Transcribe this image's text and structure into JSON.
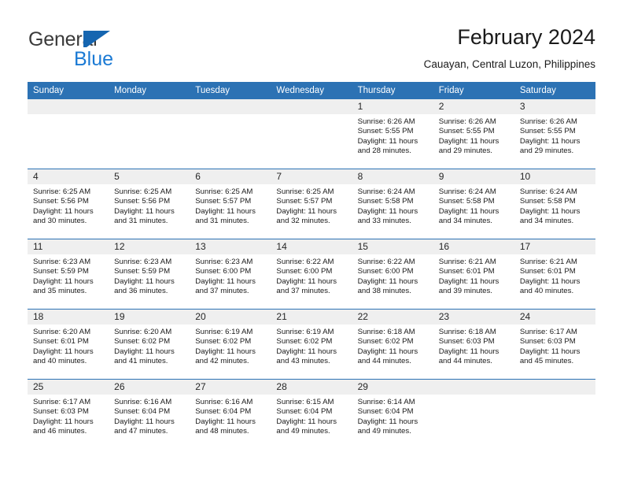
{
  "brand": {
    "name_part1": "General",
    "name_part2": "Blue",
    "flag_color": "#1565b0",
    "blue_color": "#1b7ad4"
  },
  "header": {
    "title": "February 2024",
    "subtitle": "Cauayan, Central Luzon, Philippines"
  },
  "theme": {
    "header_blue": "#2c72b4",
    "date_strip_gray": "#efefef",
    "text_color": "#1a1a1a"
  },
  "calendar": {
    "weekday_headers": [
      "Sunday",
      "Monday",
      "Tuesday",
      "Wednesday",
      "Thursday",
      "Friday",
      "Saturday"
    ],
    "weeks": [
      [
        {
          "day": "",
          "empty": true
        },
        {
          "day": "",
          "empty": true
        },
        {
          "day": "",
          "empty": true
        },
        {
          "day": "",
          "empty": true
        },
        {
          "day": "1",
          "sunrise": "Sunrise: 6:26 AM",
          "sunset": "Sunset: 5:55 PM",
          "daylight": "Daylight: 11 hours and 28 minutes."
        },
        {
          "day": "2",
          "sunrise": "Sunrise: 6:26 AM",
          "sunset": "Sunset: 5:55 PM",
          "daylight": "Daylight: 11 hours and 29 minutes."
        },
        {
          "day": "3",
          "sunrise": "Sunrise: 6:26 AM",
          "sunset": "Sunset: 5:55 PM",
          "daylight": "Daylight: 11 hours and 29 minutes."
        }
      ],
      [
        {
          "day": "4",
          "sunrise": "Sunrise: 6:25 AM",
          "sunset": "Sunset: 5:56 PM",
          "daylight": "Daylight: 11 hours and 30 minutes."
        },
        {
          "day": "5",
          "sunrise": "Sunrise: 6:25 AM",
          "sunset": "Sunset: 5:56 PM",
          "daylight": "Daylight: 11 hours and 31 minutes."
        },
        {
          "day": "6",
          "sunrise": "Sunrise: 6:25 AM",
          "sunset": "Sunset: 5:57 PM",
          "daylight": "Daylight: 11 hours and 31 minutes."
        },
        {
          "day": "7",
          "sunrise": "Sunrise: 6:25 AM",
          "sunset": "Sunset: 5:57 PM",
          "daylight": "Daylight: 11 hours and 32 minutes."
        },
        {
          "day": "8",
          "sunrise": "Sunrise: 6:24 AM",
          "sunset": "Sunset: 5:58 PM",
          "daylight": "Daylight: 11 hours and 33 minutes."
        },
        {
          "day": "9",
          "sunrise": "Sunrise: 6:24 AM",
          "sunset": "Sunset: 5:58 PM",
          "daylight": "Daylight: 11 hours and 34 minutes."
        },
        {
          "day": "10",
          "sunrise": "Sunrise: 6:24 AM",
          "sunset": "Sunset: 5:58 PM",
          "daylight": "Daylight: 11 hours and 34 minutes."
        }
      ],
      [
        {
          "day": "11",
          "sunrise": "Sunrise: 6:23 AM",
          "sunset": "Sunset: 5:59 PM",
          "daylight": "Daylight: 11 hours and 35 minutes."
        },
        {
          "day": "12",
          "sunrise": "Sunrise: 6:23 AM",
          "sunset": "Sunset: 5:59 PM",
          "daylight": "Daylight: 11 hours and 36 minutes."
        },
        {
          "day": "13",
          "sunrise": "Sunrise: 6:23 AM",
          "sunset": "Sunset: 6:00 PM",
          "daylight": "Daylight: 11 hours and 37 minutes."
        },
        {
          "day": "14",
          "sunrise": "Sunrise: 6:22 AM",
          "sunset": "Sunset: 6:00 PM",
          "daylight": "Daylight: 11 hours and 37 minutes."
        },
        {
          "day": "15",
          "sunrise": "Sunrise: 6:22 AM",
          "sunset": "Sunset: 6:00 PM",
          "daylight": "Daylight: 11 hours and 38 minutes."
        },
        {
          "day": "16",
          "sunrise": "Sunrise: 6:21 AM",
          "sunset": "Sunset: 6:01 PM",
          "daylight": "Daylight: 11 hours and 39 minutes."
        },
        {
          "day": "17",
          "sunrise": "Sunrise: 6:21 AM",
          "sunset": "Sunset: 6:01 PM",
          "daylight": "Daylight: 11 hours and 40 minutes."
        }
      ],
      [
        {
          "day": "18",
          "sunrise": "Sunrise: 6:20 AM",
          "sunset": "Sunset: 6:01 PM",
          "daylight": "Daylight: 11 hours and 40 minutes."
        },
        {
          "day": "19",
          "sunrise": "Sunrise: 6:20 AM",
          "sunset": "Sunset: 6:02 PM",
          "daylight": "Daylight: 11 hours and 41 minutes."
        },
        {
          "day": "20",
          "sunrise": "Sunrise: 6:19 AM",
          "sunset": "Sunset: 6:02 PM",
          "daylight": "Daylight: 11 hours and 42 minutes."
        },
        {
          "day": "21",
          "sunrise": "Sunrise: 6:19 AM",
          "sunset": "Sunset: 6:02 PM",
          "daylight": "Daylight: 11 hours and 43 minutes."
        },
        {
          "day": "22",
          "sunrise": "Sunrise: 6:18 AM",
          "sunset": "Sunset: 6:02 PM",
          "daylight": "Daylight: 11 hours and 44 minutes."
        },
        {
          "day": "23",
          "sunrise": "Sunrise: 6:18 AM",
          "sunset": "Sunset: 6:03 PM",
          "daylight": "Daylight: 11 hours and 44 minutes."
        },
        {
          "day": "24",
          "sunrise": "Sunrise: 6:17 AM",
          "sunset": "Sunset: 6:03 PM",
          "daylight": "Daylight: 11 hours and 45 minutes."
        }
      ],
      [
        {
          "day": "25",
          "sunrise": "Sunrise: 6:17 AM",
          "sunset": "Sunset: 6:03 PM",
          "daylight": "Daylight: 11 hours and 46 minutes."
        },
        {
          "day": "26",
          "sunrise": "Sunrise: 6:16 AM",
          "sunset": "Sunset: 6:04 PM",
          "daylight": "Daylight: 11 hours and 47 minutes."
        },
        {
          "day": "27",
          "sunrise": "Sunrise: 6:16 AM",
          "sunset": "Sunset: 6:04 PM",
          "daylight": "Daylight: 11 hours and 48 minutes."
        },
        {
          "day": "28",
          "sunrise": "Sunrise: 6:15 AM",
          "sunset": "Sunset: 6:04 PM",
          "daylight": "Daylight: 11 hours and 49 minutes."
        },
        {
          "day": "29",
          "sunrise": "Sunrise: 6:14 AM",
          "sunset": "Sunset: 6:04 PM",
          "daylight": "Daylight: 11 hours and 49 minutes."
        },
        {
          "day": "",
          "empty": true
        },
        {
          "day": "",
          "empty": true
        }
      ]
    ]
  }
}
